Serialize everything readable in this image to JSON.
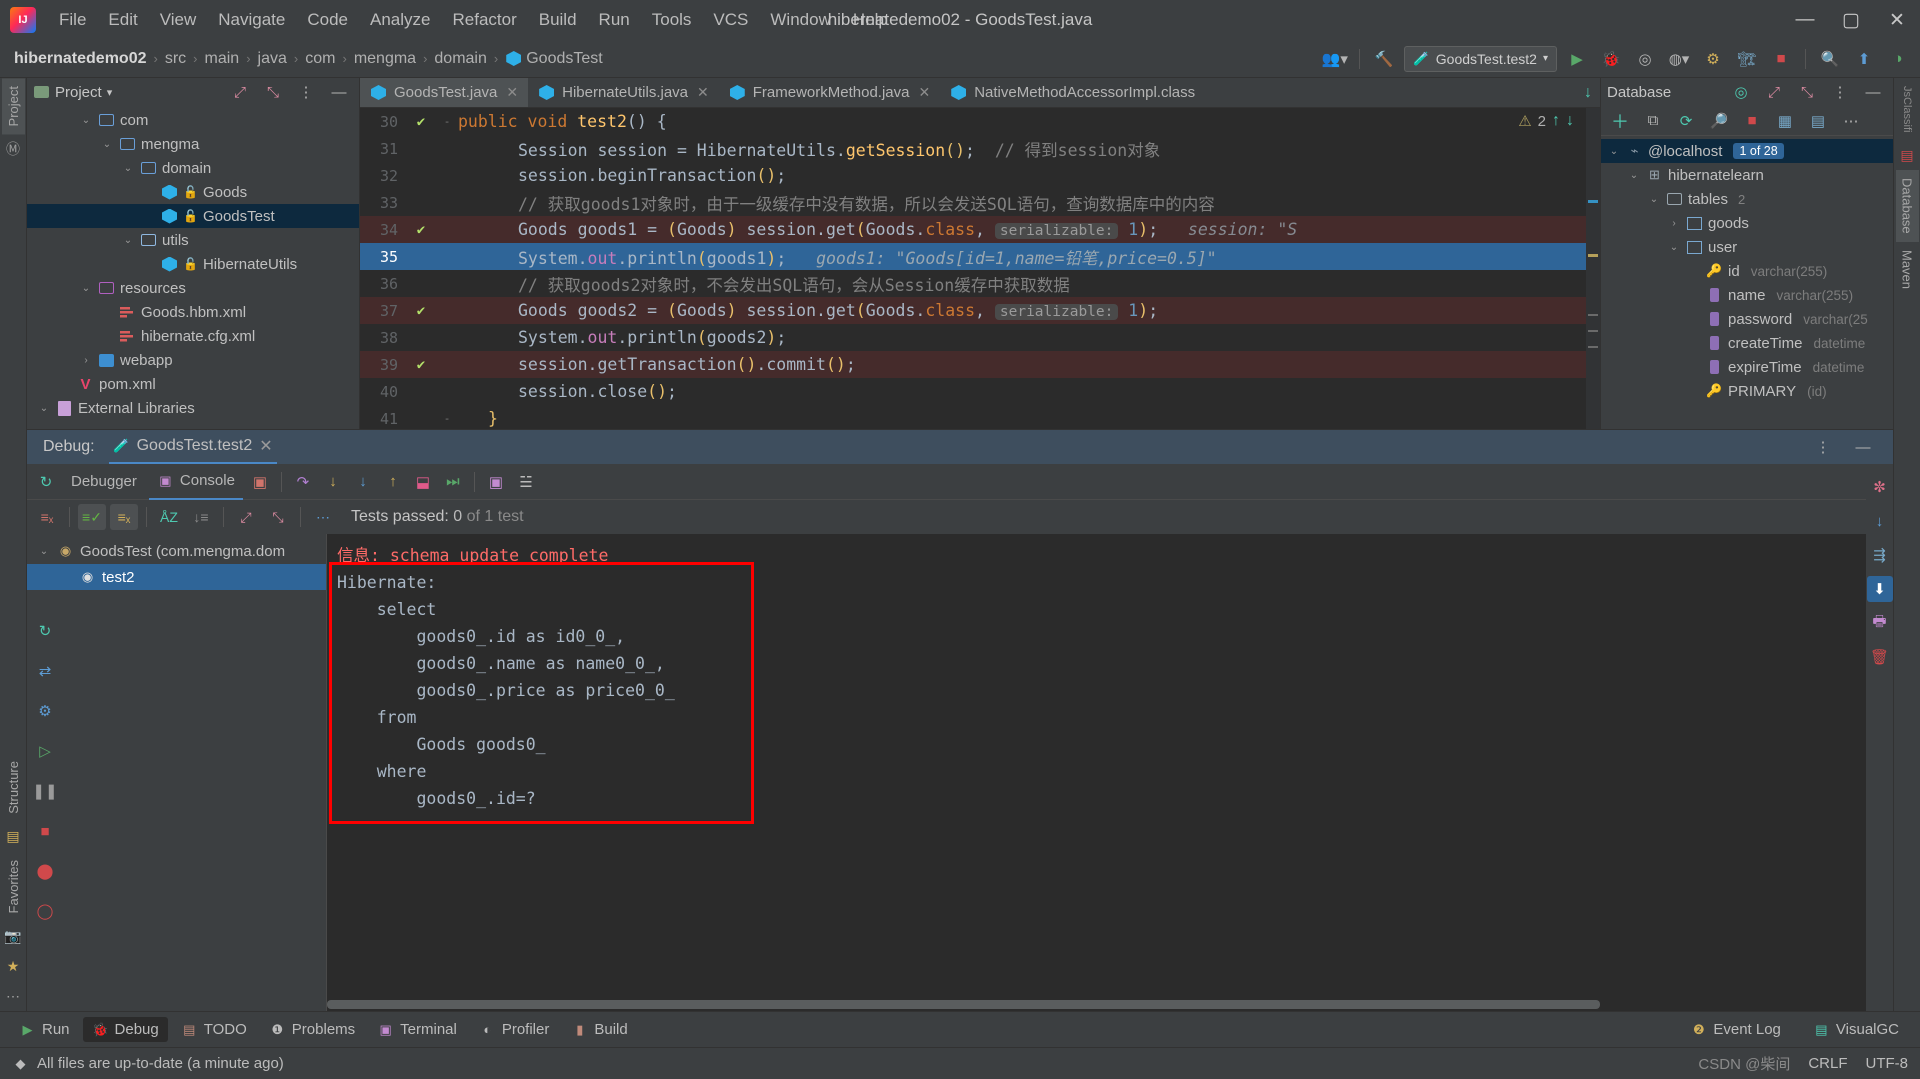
{
  "window": {
    "title": "hibernatedemo02 - GoodsTest.java",
    "minimize": "—",
    "maximize": "▢",
    "close": "✕",
    "logo": "intellij-idea-logo"
  },
  "menu": [
    "File",
    "Edit",
    "View",
    "Navigate",
    "Code",
    "Analyze",
    "Refactor",
    "Build",
    "Run",
    "Tools",
    "VCS",
    "Window",
    "Help"
  ],
  "navbar": {
    "crumbs": [
      "hibernatedemo02",
      "src",
      "main",
      "java",
      "com",
      "mengma",
      "domain",
      "GoodsTest"
    ],
    "run_config": "GoodsTest.test2",
    "icons": [
      "members-icon",
      "hammer-icon",
      "run-icon",
      "debug-icon",
      "run-with-coverage-icon",
      "profile-icon",
      "inspect-icon",
      "build-icon",
      "stop-icon",
      "search-icon",
      "update-icon",
      "browser-icon"
    ]
  },
  "left_strip": {
    "tabs": [
      "Project",
      "Structure",
      "Favorites"
    ],
    "icons": [
      "maven-icon",
      "bookmarks-icon",
      "camera-icon",
      "more-icon"
    ]
  },
  "right_strip": {
    "tabs": [
      "Database",
      "Maven"
    ],
    "icons": [
      "classes-icon"
    ]
  },
  "project": {
    "title": "Project",
    "expand_icon": "expand-icon",
    "collapse_icon": "collapse-icon",
    "settings_icon": "more-icon",
    "hide_icon": "hide-icon",
    "items": [
      {
        "label": "com",
        "indent": 2,
        "chev": "v",
        "icon": "folder-icon",
        "type": "folder"
      },
      {
        "label": "mengma",
        "indent": 3,
        "chev": "v",
        "icon": "folder-icon",
        "type": "folder"
      },
      {
        "label": "domain",
        "indent": 4,
        "chev": "v",
        "icon": "folder-icon",
        "type": "folder"
      },
      {
        "label": "Goods",
        "indent": 5,
        "chev": "",
        "icon": "java-class-icon",
        "type": "class",
        "lock": true
      },
      {
        "label": "GoodsTest",
        "indent": 5,
        "chev": "",
        "icon": "java-test-class-icon",
        "type": "class",
        "lock": true,
        "selected": true
      },
      {
        "label": "utils",
        "indent": 4,
        "chev": "v",
        "icon": "folder-source-icon",
        "type": "folder-src"
      },
      {
        "label": "HibernateUtils",
        "indent": 5,
        "chev": "",
        "icon": "java-class-icon",
        "type": "class",
        "lock": true
      },
      {
        "label": "resources",
        "indent": 2,
        "chev": "v",
        "icon": "resources-folder-icon",
        "type": "resources"
      },
      {
        "label": "Goods.hbm.xml",
        "indent": 3,
        "chev": "",
        "icon": "xml-file-icon",
        "type": "xml"
      },
      {
        "label": "hibernate.cfg.xml",
        "indent": 3,
        "chev": "",
        "icon": "xml-file-icon",
        "type": "xml"
      },
      {
        "label": "webapp",
        "indent": 2,
        "chev": ">",
        "icon": "webapp-folder-icon",
        "type": "webapp"
      },
      {
        "label": "pom.xml",
        "indent": 1,
        "chev": "",
        "icon": "maven-pom-icon",
        "type": "pom"
      },
      {
        "label": "External Libraries",
        "indent": 0,
        "chev": "v",
        "icon": "library-icon",
        "type": "lib"
      }
    ]
  },
  "editor": {
    "tabs": [
      {
        "label": "GoodsTest.java",
        "icon": "java-test-class-icon",
        "active": true,
        "close": "✕"
      },
      {
        "label": "HibernateUtils.java",
        "icon": "java-class-icon",
        "active": false,
        "close": "✕"
      },
      {
        "label": "FrameworkMethod.java",
        "icon": "java-class-icon",
        "active": false,
        "close": "✕"
      },
      {
        "label": "NativeMethodAccessorImpl.class",
        "icon": "java-class-icon",
        "active": false,
        "close": ""
      }
    ],
    "tabs_more_icon": "chevron-down-icon",
    "inspections": {
      "warning_count": "2",
      "warn_icon": "warning-triangle-icon",
      "up_icon": "↑",
      "down_icon": "↓"
    },
    "lines": [
      {
        "num": "30",
        "gutter": "run-ok",
        "fold": "-",
        "highlight": "none",
        "tokens": [
          {
            "t": "public ",
            "c": "kw"
          },
          {
            "t": "void ",
            "c": "kw"
          },
          {
            "t": "test2",
            "c": "fn"
          },
          {
            "t": "() {",
            "c": "pun"
          }
        ]
      },
      {
        "num": "31",
        "gutter": "",
        "fold": "",
        "highlight": "none",
        "indent": 2,
        "tokens": [
          {
            "t": "Session session = HibernateUtils.",
            "c": "cls"
          },
          {
            "t": "getSession",
            "c": "cls-i"
          },
          {
            "t": "()",
            "c": "paren"
          },
          {
            "t": ";",
            "c": "pun"
          },
          {
            "t": "  // 得到session对象",
            "c": "cmt"
          }
        ]
      },
      {
        "num": "32",
        "gutter": "",
        "fold": "",
        "highlight": "none",
        "indent": 2,
        "tokens": [
          {
            "t": "session.beginTransaction",
            "c": "cls"
          },
          {
            "t": "()",
            "c": "paren"
          },
          {
            "t": ";",
            "c": "pun"
          }
        ]
      },
      {
        "num": "33",
        "gutter": "",
        "fold": "",
        "highlight": "none",
        "indent": 2,
        "tokens": [
          {
            "t": "// 获取goods1对象时，由于一级缓存中没有数据，所以会发送SQL语句，查询数据库中的内容",
            "c": "cmt"
          }
        ]
      },
      {
        "num": "34",
        "gutter": "run-ok",
        "fold": "",
        "highlight": "red",
        "indent": 2,
        "tokens": [
          {
            "t": "Goods goods1 = ",
            "c": "cls"
          },
          {
            "t": "(",
            "c": "paren"
          },
          {
            "t": "Goods",
            "c": "cls"
          },
          {
            "t": ")",
            "c": "paren"
          },
          {
            "t": " session.get",
            "c": "cls"
          },
          {
            "t": "(",
            "c": "paren"
          },
          {
            "t": "Goods.",
            "c": "cls"
          },
          {
            "t": "class",
            "c": "kw"
          },
          {
            "t": ", ",
            "c": "pun"
          },
          {
            "t": "serializable:",
            "c": "hint"
          },
          {
            "t": " 1",
            "c": "num"
          },
          {
            "t": ")",
            "c": "paren"
          },
          {
            "t": ";",
            "c": "pun"
          },
          {
            "t": "   session: ",
            "c": "inlay"
          },
          {
            "t": "\"S",
            "c": "inlay"
          }
        ]
      },
      {
        "num": "35",
        "gutter": "",
        "fold": "",
        "highlight": "blue",
        "indent": 2,
        "tokens": [
          {
            "t": "System.",
            "c": "cls"
          },
          {
            "t": "out",
            "c": "fld2"
          },
          {
            "t": ".println",
            "c": "cls"
          },
          {
            "t": "(",
            "c": "paren"
          },
          {
            "t": "goods1",
            "c": "cls"
          },
          {
            "t": ")",
            "c": "paren"
          },
          {
            "t": ";",
            "c": "pun"
          },
          {
            "t": "   goods1: \"Goods[id=1,name=铅笔,price=0.5]\"",
            "c": "inlay-s"
          }
        ]
      },
      {
        "num": "36",
        "gutter": "",
        "fold": "",
        "highlight": "none",
        "indent": 2,
        "tokens": [
          {
            "t": "// 获取goods2对象时，不会发出SQL语句，会从Session缓存中获取数据",
            "c": "cmt"
          }
        ]
      },
      {
        "num": "37",
        "gutter": "run-ok",
        "fold": "",
        "highlight": "red",
        "indent": 2,
        "tokens": [
          {
            "t": "Goods goods2 = ",
            "c": "cls"
          },
          {
            "t": "(",
            "c": "paren"
          },
          {
            "t": "Goods",
            "c": "cls"
          },
          {
            "t": ")",
            "c": "paren"
          },
          {
            "t": " session.get",
            "c": "cls"
          },
          {
            "t": "(",
            "c": "paren"
          },
          {
            "t": "Goods.",
            "c": "cls"
          },
          {
            "t": "class",
            "c": "kw"
          },
          {
            "t": ", ",
            "c": "pun"
          },
          {
            "t": "serializable:",
            "c": "hint"
          },
          {
            "t": " 1",
            "c": "num"
          },
          {
            "t": ")",
            "c": "paren"
          },
          {
            "t": ";",
            "c": "pun"
          }
        ]
      },
      {
        "num": "38",
        "gutter": "",
        "fold": "",
        "highlight": "none",
        "indent": 2,
        "tokens": [
          {
            "t": "System.",
            "c": "cls"
          },
          {
            "t": "out",
            "c": "fld2"
          },
          {
            "t": ".println",
            "c": "cls"
          },
          {
            "t": "(",
            "c": "paren"
          },
          {
            "t": "goods2",
            "c": "cls"
          },
          {
            "t": ")",
            "c": "paren"
          },
          {
            "t": ";",
            "c": "pun"
          }
        ]
      },
      {
        "num": "39",
        "gutter": "run-ok",
        "fold": "",
        "highlight": "red",
        "indent": 2,
        "tokens": [
          {
            "t": "session.getTransaction",
            "c": "cls"
          },
          {
            "t": "()",
            "c": "paren"
          },
          {
            "t": ".commit",
            "c": "cls"
          },
          {
            "t": "()",
            "c": "paren"
          },
          {
            "t": ";",
            "c": "pun"
          }
        ]
      },
      {
        "num": "40",
        "gutter": "",
        "fold": "",
        "highlight": "none",
        "indent": 2,
        "tokens": [
          {
            "t": "session.close",
            "c": "cls"
          },
          {
            "t": "()",
            "c": "paren"
          },
          {
            "t": ";",
            "c": "pun"
          }
        ]
      },
      {
        "num": "41",
        "gutter": "",
        "fold": "-",
        "highlight": "none",
        "indent": 1,
        "tokens": [
          {
            "t": "}",
            "c": "paren"
          }
        ]
      }
    ]
  },
  "database": {
    "title": "Database",
    "toolbar_icons": [
      "add-icon",
      "copy-icon",
      "refresh-icon",
      "search-icon",
      "stop-icon",
      "table-icon",
      "more-icon",
      "hide-icon"
    ],
    "sync_icon": "sync-icon",
    "expand_icon": "expand-icon",
    "collapse_icon": "collapse-icon",
    "items": [
      {
        "label": "@localhost",
        "indent": 0,
        "chev": "v",
        "icon": "datasource-icon",
        "badge": "1 of 28",
        "selected": true
      },
      {
        "label": "hibernatelearn",
        "indent": 1,
        "chev": "v",
        "icon": "schema-icon"
      },
      {
        "label": "tables",
        "indent": 2,
        "chev": "v",
        "icon": "folder-icon",
        "count": "2"
      },
      {
        "label": "goods",
        "indent": 3,
        "chev": ">",
        "icon": "table-icon"
      },
      {
        "label": "user",
        "indent": 3,
        "chev": "v",
        "icon": "table-icon"
      },
      {
        "label": "id",
        "indent": 4,
        "chev": "",
        "icon": "primary-key-icon",
        "type": "varchar(255)"
      },
      {
        "label": "name",
        "indent": 4,
        "chev": "",
        "icon": "column-icon",
        "type": "varchar(255)"
      },
      {
        "label": "password",
        "indent": 4,
        "chev": "",
        "icon": "column-icon",
        "type": "varchar(25"
      },
      {
        "label": "createTime",
        "indent": 4,
        "chev": "",
        "icon": "column-icon",
        "type": "datetime"
      },
      {
        "label": "expireTime",
        "indent": 4,
        "chev": "",
        "icon": "column-icon",
        "type": "datetime"
      },
      {
        "label": "PRIMARY",
        "indent": 4,
        "chev": "",
        "icon": "key-icon",
        "type": "(id)"
      }
    ]
  },
  "debug": {
    "header_label": "Debug:",
    "session_tab": "GoodsTest.test2",
    "session_close": "✕",
    "session_icon": "test-tube-icon",
    "more_icon": "more-icon",
    "hide_icon": "hide-icon",
    "restore_icon": "rerun-icon",
    "tabs": [
      {
        "label": "Debugger",
        "icon": "debugger-icon",
        "active": false
      },
      {
        "label": "Console",
        "icon": "console-icon",
        "active": true
      }
    ],
    "tab_icons": [
      "layout-icon"
    ],
    "step_icons": [
      "step-over-icon",
      "step-into-icon",
      "force-step-into-icon",
      "step-out-icon",
      "drop-frame-icon",
      "run-to-cursor-icon",
      "evaluate-icon",
      "settings-list-icon"
    ],
    "test_toolbar_icons": [
      "rerun-failed-icon",
      "show-passed-icon",
      "show-ignored-icon",
      "sort-alpha-icon",
      "sort-duration-icon",
      "expand-all-icon",
      "collapse-all-icon",
      "more-icon"
    ],
    "tests_passed_label": "Tests passed:",
    "tests_passed_count": "0",
    "tests_passed_total": "of 1 test",
    "tree": [
      {
        "label": "GoodsTest (com.mengma.dom",
        "indent": 0,
        "chev": "v",
        "icon": "test-suite-icon",
        "selected": false
      },
      {
        "label": "test2",
        "indent": 1,
        "chev": "",
        "icon": "test-paused-icon",
        "selected": true
      }
    ],
    "console_lines": [
      {
        "text": "信息: schema update complete",
        "color": "red"
      },
      {
        "text": "Hibernate: ",
        "color": "normal"
      },
      {
        "text": "    select",
        "color": "normal"
      },
      {
        "text": "        goods0_.id as id0_0_,",
        "color": "normal"
      },
      {
        "text": "        goods0_.name as name0_0_,",
        "color": "normal"
      },
      {
        "text": "        goods0_.price as price0_0_",
        "color": "normal"
      },
      {
        "text": "    from",
        "color": "normal"
      },
      {
        "text": "        Goods goods0_",
        "color": "normal"
      },
      {
        "text": "    where",
        "color": "normal"
      },
      {
        "text": "        goods0_.id=?",
        "color": "normal"
      }
    ],
    "side_icons": [
      "settings-icon",
      "scroll-down-icon",
      "soft-wrap-icon",
      "export-icon",
      "print-icon",
      "clear-all-icon"
    ],
    "left_icons": [
      "rerun-icon",
      "resume-icon",
      "pause-icon",
      "stop-icon",
      "breakpoints-icon",
      "mute-breakpoints-icon",
      "settings-icon"
    ]
  },
  "toolwindows": {
    "buttons": [
      {
        "label": "Run",
        "icon": "run-icon",
        "active": false
      },
      {
        "label": "Debug",
        "icon": "debug-icon",
        "active": true
      },
      {
        "label": "TODO",
        "icon": "todo-icon",
        "active": false
      },
      {
        "label": "Problems",
        "icon": "problems-icon",
        "active": false
      },
      {
        "label": "Terminal",
        "icon": "terminal-icon",
        "active": false
      },
      {
        "label": "Profiler",
        "icon": "profiler-icon",
        "active": false
      },
      {
        "label": "Build",
        "icon": "build-icon",
        "active": false
      }
    ],
    "right": [
      {
        "label": "Event Log",
        "icon": "event-log-icon"
      },
      {
        "label": "VisualGC",
        "icon": "visualgc-icon"
      }
    ]
  },
  "statusbar": {
    "message": "All files are up-to-date (a minute ago)",
    "icon": "sync-status-icon",
    "line_sep": "CRLF",
    "encoding": "UTF-8",
    "watermark": "CSDN @柴间"
  },
  "colors": {
    "accent_blue": "#2f6598",
    "selection_navy": "#0d293e",
    "error_red": "#ff0000",
    "console_red": "#ff6b68",
    "panel_bg": "#3c3f41",
    "editor_bg": "#2b2b2b",
    "line_red": "#452b2b"
  }
}
